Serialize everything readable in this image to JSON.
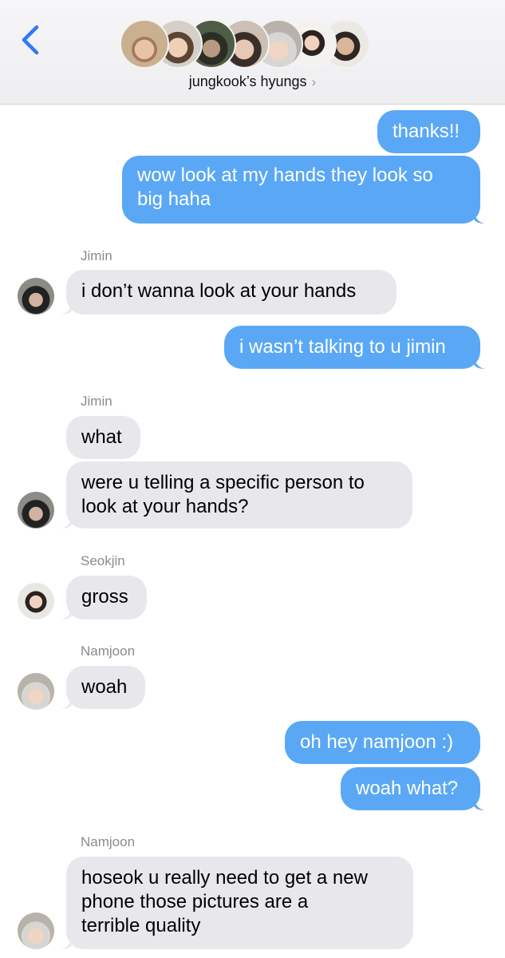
{
  "header": {
    "group_name": "jungkook’s hyungs",
    "chevron": "›",
    "back_icon": "chevron-left-icon",
    "accent": "#3478f6"
  },
  "colors": {
    "outgoing": "#5aa8f5",
    "incoming": "#e8e8ec"
  },
  "messages": {
    "m1": "thanks!!",
    "m2a": "wow look at my hands they look so",
    "m2b": "big haha",
    "s1": "Jimin",
    "m3": "i don’t wanna look at your hands",
    "m4": "i wasn’t talking to u jimin",
    "s2": "Jimin",
    "m5": "what",
    "m6a": "were u telling a specific person to",
    "m6b": "look at your hands?",
    "s3": "Seokjin",
    "m7": "gross",
    "s4": "Namjoon",
    "m8": "woah",
    "m9": "oh hey namjoon :)",
    "m10": "woah what?",
    "s5": "Namjoon",
    "m11a": "hoseok u really need to get a new",
    "m11b": "phone those pictures are a",
    "m11c": "terrible quality"
  }
}
